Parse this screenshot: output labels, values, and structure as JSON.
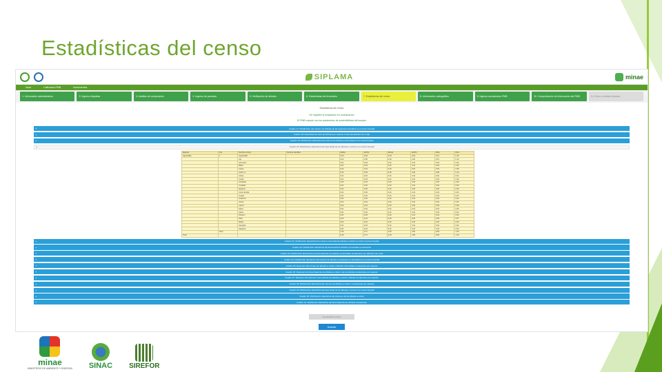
{
  "slide": {
    "title": "Estadísticas del censo"
  },
  "app": {
    "brand_center": "SIPLAMA",
    "brand_right": "minae",
    "nav": [
      "Inicio",
      "Unificados PMB",
      "Instrumentos"
    ],
    "steps": [
      {
        "label": "1. Información administrativa",
        "state": "done"
      },
      {
        "label": "2. Ingreso etiquetas",
        "state": "done"
      },
      {
        "label": "3. Análisis de composición",
        "state": "done"
      },
      {
        "label": "4. Ingreso de parcelas",
        "state": "done"
      },
      {
        "label": "5. Verificación de árboles",
        "state": "done"
      },
      {
        "label": "6. Estadísticas del inventario",
        "state": "done"
      },
      {
        "label": "7. Estadísticas del censo",
        "state": "active"
      },
      {
        "label": "8. Información cartográfica",
        "state": "done"
      },
      {
        "label": "9. Ingreso anotaciones PMB",
        "state": "done"
      },
      {
        "label": "10. Comprobación de información del PMB",
        "state": "done"
      },
      {
        "label": "11. Envío a revisión técnica",
        "state": "disabled"
      }
    ],
    "content": {
      "heading": "Estadísticas del censo",
      "note_1": "Se requiere la evaluación en coordinación",
      "note_2": "El PMB cumple con los parámetros de sostenibilidad del bosque",
      "accordion_top": [
        "Cuadro 17: Distribución del número de árboles de las especies forestales en el censo forestal",
        "Cuadro 18: Intensidad de corta de árboles por especie comercial (árboles de corta)",
        "Cuadro 19: Distribución diamétrica del número de árboles y área basal en el censo forestal",
        "Cuadro 20: Distribución diamétrica del área basal de los árboles a cortar en el censo forestal"
      ],
      "table": {
        "headers": [
          "Especie",
          "Gru",
          "Nombre comun",
          "Nombre cientifico",
          "Ab/Ha",
          "Ab/Tot",
          "Ab/Ha",
          "Ab/Tot",
          "N/ha",
          "N/tot"
        ],
        "rows": [
          [
            "Aguacatillo",
            "1",
            "Aguacatillo",
            "",
            "0.03",
            "0.09",
            "0.03",
            "0.20",
            "0.12",
            "0.15"
          ],
          [
            "",
            "",
            "Ajo",
            "",
            "0.02",
            "0.05",
            "0.02",
            "0.20",
            "0.07",
            "0.10"
          ],
          [
            "",
            "",
            "Almendro",
            "",
            "0.01",
            "0.03",
            "0.01",
            "0.10",
            "0.04",
            "0.06"
          ],
          [
            "",
            "",
            "Balso",
            "",
            "0.01",
            "0.02",
            "0.01",
            "0.10",
            "0.03",
            "0.05"
          ],
          [
            "",
            "",
            "Cedro",
            "",
            "0.02",
            "0.04",
            "0.02",
            "0.20",
            "0.06",
            "0.08"
          ],
          [
            "",
            "",
            "Cedro m",
            "",
            "0.02",
            "0.05",
            "0.02",
            "0.20",
            "0.08",
            "0.10"
          ],
          [
            "",
            "",
            "Ceiba",
            "",
            "0.01",
            "0.02",
            "0.01",
            "0.10",
            "0.02",
            "0.04"
          ],
          [
            "",
            "",
            "Cerillo",
            "",
            "0.01",
            "0.03",
            "0.01",
            "0.10",
            "0.04",
            "0.06"
          ],
          [
            "",
            "",
            "Cristóbal",
            "",
            "0.02",
            "0.04",
            "0.02",
            "0.20",
            "0.05",
            "0.08"
          ],
          [
            "",
            "",
            "Cuajada",
            "",
            "0.01",
            "0.02",
            "0.01",
            "0.10",
            "0.03",
            "0.05"
          ],
          [
            "",
            "",
            "Espavel",
            "",
            "0.02",
            "0.05",
            "0.02",
            "0.20",
            "0.06",
            "0.09"
          ],
          [
            "",
            "",
            "Fruta dorada",
            "",
            "0.01",
            "0.03",
            "0.01",
            "0.10",
            "0.04",
            "0.06"
          ],
          [
            "",
            "",
            "Guaba",
            "",
            "0.01",
            "0.02",
            "0.01",
            "0.10",
            "0.03",
            "0.04"
          ],
          [
            "",
            "",
            "Guácimo",
            "",
            "0.01",
            "0.02",
            "0.01",
            "0.10",
            "0.02",
            "0.04"
          ],
          [
            "",
            "",
            "Jícaro",
            "",
            "0.01",
            "0.03",
            "0.01",
            "0.10",
            "0.04",
            "0.05"
          ],
          [
            "",
            "",
            "Laurel",
            "",
            "0.02",
            "0.04",
            "0.02",
            "0.20",
            "0.05",
            "0.08"
          ],
          [
            "",
            "",
            "Manú",
            "",
            "0.01",
            "0.02",
            "0.01",
            "0.10",
            "0.03",
            "0.05"
          ],
          [
            "",
            "",
            "María",
            "",
            "0.01",
            "0.02",
            "0.01",
            "0.10",
            "0.03",
            "0.04"
          ],
          [
            "",
            "",
            "Níspero",
            "",
            "0.01",
            "0.03",
            "0.01",
            "0.10",
            "0.04",
            "0.06"
          ],
          [
            "",
            "",
            "Pilón",
            "",
            "0.02",
            "0.04",
            "0.02",
            "0.20",
            "0.05",
            "0.07"
          ],
          [
            "",
            "",
            "Roble",
            "",
            "0.01",
            "0.02",
            "0.01",
            "0.10",
            "0.03",
            "0.05"
          ],
          [
            "",
            "",
            "Sangrillo",
            "",
            "0.01",
            "0.03",
            "0.01",
            "0.10",
            "0.04",
            "0.06"
          ],
          [
            "",
            "",
            "Zapatero",
            "",
            "0.01",
            "0.02",
            "0.01",
            "0.10",
            "0.03",
            "0.04"
          ],
          [
            "",
            "Total",
            "",
            "",
            "0.30",
            "0.71",
            "0.30",
            "2.90",
            "0.95",
            "1.43"
          ],
          [
            "Total",
            "",
            "",
            "",
            "0.30",
            "0.71",
            "0.30",
            "2.90",
            "0.95",
            "1.43"
          ]
        ]
      },
      "accordion_bottom": [
        "Cuadro 21: Distribución diamétrica del número comercial de árboles a extraer en todo el censo forestal",
        "Cuadro 22: Distribución diamétrica del área basal de árboles comerciales remanentes",
        "Cuadro 23: Distribución diamétrica del área basal de los árboles comerciales remanentes con diámetro de corta",
        "Cuadro 24: Distribución diamétrica del número de árboles remanentes no deseados en el censo forestal",
        "Cuadro 25: Resumen del número de árboles a cortar y árboles comerciales remanentes por especie",
        "Cuadro 26: Resumen del área basal de los árboles a cortar y de los árboles remanentes por especie",
        "Cuadro 27: Resumen del volumen comercial de los árboles a cortar y árboles remanentes por especie",
        "Cuadro 28: Distribución diamétrica del número de árboles a cortar y remanentes por especie",
        "Cuadro 29: Distribución diamétrica del área basal de los árboles a cortar en el censo forestal",
        "Cuadro 30: Distribución diamétrica del volumen de los árboles a cortar",
        "Cuadro 31: Distribución diamétrica del área basal de los árboles remanentes"
      ],
      "footer_input": "Comentarios a favor",
      "footer_button": "Guardar"
    }
  },
  "logos": {
    "minae_text": "minae",
    "minae_sub": "MINISTERIO DE AMBIENTE Y ENERGÍA",
    "sinac_text": "SINAC",
    "sirefor_text": "SIREFOR"
  }
}
